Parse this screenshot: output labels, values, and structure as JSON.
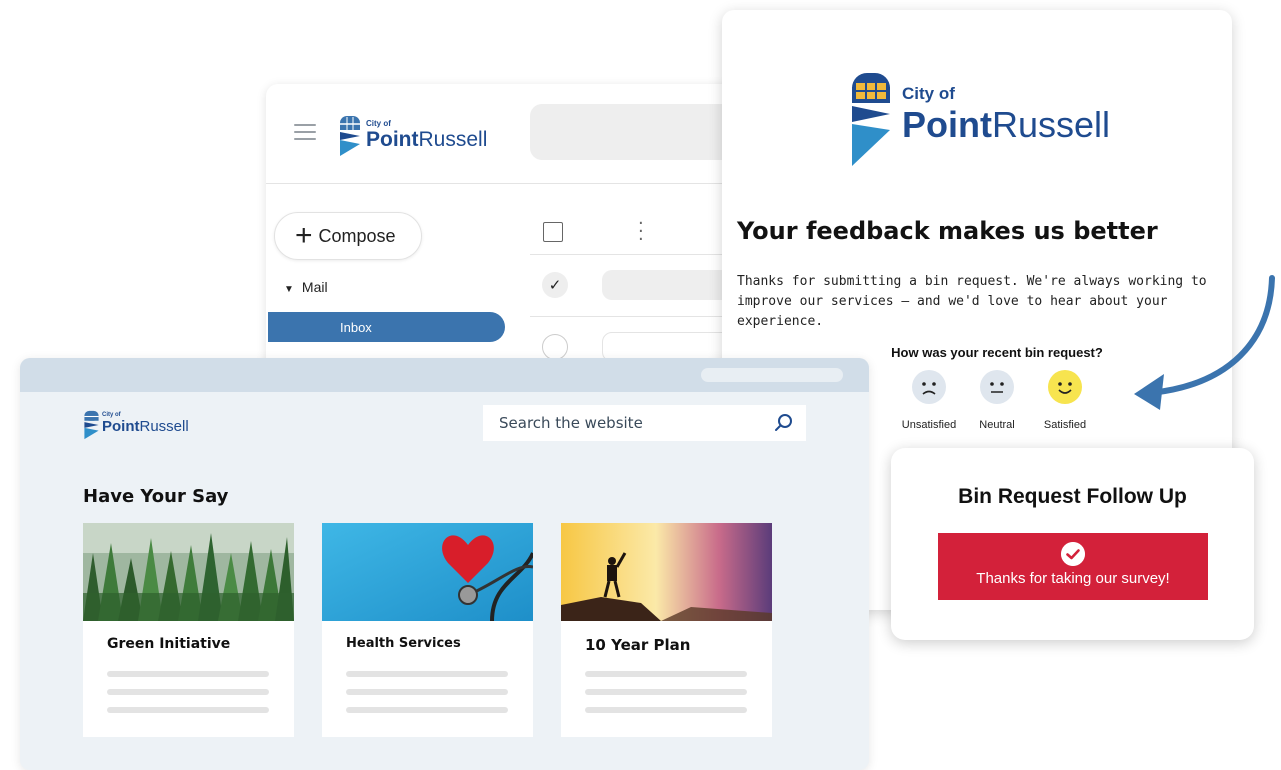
{
  "brand": {
    "city_of": "City of",
    "point": "Point",
    "russell": "Russell"
  },
  "email_client": {
    "compose_label": "Compose",
    "mail_label": "Mail",
    "inbox_label": "Inbox",
    "icons": [
      "menu-icon",
      "plus-icon",
      "checkbox-icon",
      "more-vert-icon",
      "check-icon"
    ]
  },
  "feedback_email": {
    "headline": "Your feedback makes us better",
    "body": "Thanks for submitting a bin request. We're always working to improve our services — and we'd love to hear about your experience.",
    "question": "How was your recent bin request?",
    "options": [
      {
        "label": "Unsatisfied",
        "icon": "sad-face-icon",
        "color": "#dfe6ee"
      },
      {
        "label": "Neutral",
        "icon": "neutral-face-icon",
        "color": "#dfe6ee"
      },
      {
        "label": "Satisfied",
        "icon": "happy-face-icon",
        "color": "#f7e44f"
      }
    ]
  },
  "followup": {
    "title": "Bin Request Follow Up",
    "message": "Thanks for taking our survey!",
    "accent": "#d3213a"
  },
  "website": {
    "search_placeholder": "Search the website",
    "section_title": "Have Your Say",
    "cards": [
      {
        "title": "Green Initiative",
        "image": "forest-image"
      },
      {
        "title": "Health Services",
        "image": "heart-stethoscope-image"
      },
      {
        "title": "10 Year Plan",
        "image": "hiker-sunset-image"
      }
    ]
  },
  "colors": {
    "brand_blue": "#1f4b8f",
    "inbox_blue": "#3b74ae",
    "website_bg": "#edf2f6"
  }
}
